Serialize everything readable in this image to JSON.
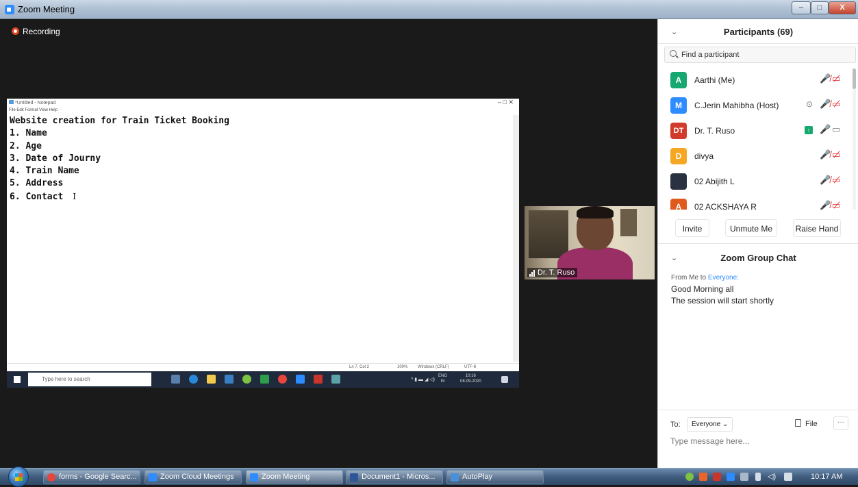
{
  "window": {
    "title": "Zoom Meeting",
    "minimize": "–",
    "maximize": "□",
    "close": "X"
  },
  "recording": {
    "label": "Recording",
    "color": "#e8421d"
  },
  "notepad": {
    "title": "*Untitled - Notepad",
    "menu": "File  Edit  Format  View  Help",
    "controls": "–    □    ✕",
    "lines": [
      "Website creation for Train Ticket Booking",
      "1. Name",
      "2. Age",
      "3. Date of Journy",
      "4. Train Name",
      "5. Address",
      "6. Contact"
    ],
    "cursor": "I",
    "status": {
      "position": "Ln 7, Col 2",
      "zoom": "100%",
      "eol": "Windows (CRLF)",
      "encoding": "UTF-8"
    },
    "taskbar": {
      "search_placeholder": "Type here to search",
      "lang_line1": "ENG",
      "lang_line2": "IN",
      "time": "10:16",
      "date": "08-09-2020"
    }
  },
  "video": {
    "name": "Dr. T. Ruso"
  },
  "participants": {
    "title": "Participants (69)",
    "search_placeholder": "Find a participant",
    "items": [
      {
        "initial": "A",
        "name": "Aarthi (Me)",
        "color": "#17a870",
        "mic": "muted",
        "cam": "off"
      },
      {
        "initial": "M",
        "name": "C.Jerin Mahibha (Host)",
        "color": "#2d8cff",
        "mic": "muted",
        "cam": "off"
      },
      {
        "initial": "DT",
        "name": "Dr. T. Ruso",
        "color": "#d23b2b",
        "mic": "on",
        "cam": "on"
      },
      {
        "initial": "D",
        "name": "divya",
        "color": "#f5a623",
        "mic": "muted",
        "cam": "off"
      },
      {
        "initial": "",
        "name": "02 Abijith L",
        "color": "#2a3140",
        "mic": "muted",
        "cam": "off"
      },
      {
        "initial": "A",
        "name": "02 ACKSHAYA R",
        "color": "#e05a1e",
        "mic": "muted",
        "cam": "off"
      }
    ],
    "buttons": {
      "invite": "Invite",
      "unmute": "Unmute Me",
      "raise_hand": "Raise Hand"
    }
  },
  "chat": {
    "title": "Zoom Group Chat",
    "from_prefix": "From Me to ",
    "from_target": "Everyone:",
    "messages": [
      "Good Morning all",
      "The session will start shortly"
    ],
    "to_label": "To:",
    "to_value": "Everyone ⌄",
    "file_label": "File",
    "more_label": "···",
    "input_placeholder": "Type message here..."
  },
  "taskbar": {
    "items": [
      {
        "label": "forms - Google Searc...",
        "color": "#e8453c"
      },
      {
        "label": "Zoom Cloud Meetings",
        "color": "#2d8cff"
      },
      {
        "label": "Zoom Meeting",
        "color": "#2d8cff"
      },
      {
        "label": "Document1 - Micros...",
        "color": "#2b5797"
      },
      {
        "label": "AutoPlay",
        "color": "#4a90d9"
      }
    ],
    "clock": "10:17 AM"
  }
}
